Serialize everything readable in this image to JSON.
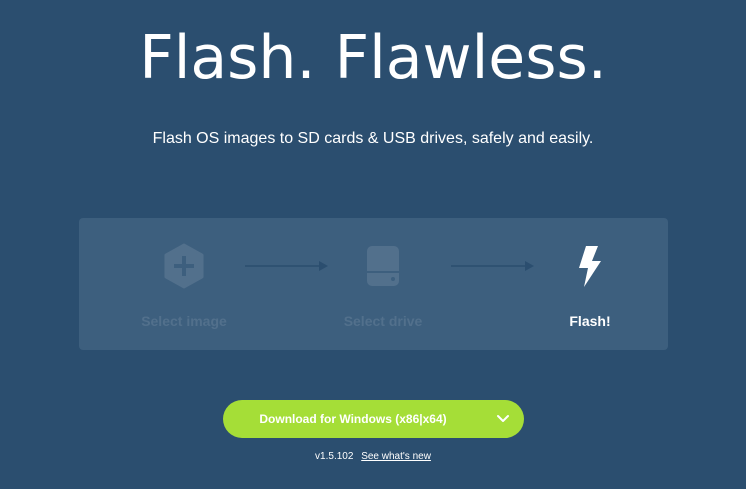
{
  "hero": {
    "title": "Flash. Flawless.",
    "subtitle": "Flash OS images to SD cards & USB drives, safely and easily."
  },
  "steps": [
    {
      "label": "Select image",
      "icon": "plus-hexagon-icon",
      "state": "disabled"
    },
    {
      "label": "Select drive",
      "icon": "drive-icon",
      "state": "disabled"
    },
    {
      "label": "Flash!",
      "icon": "lightning-icon",
      "state": "active"
    }
  ],
  "download": {
    "label": "Download for Windows (x86|x64)",
    "icon": "chevron-down-icon"
  },
  "version": {
    "number": "v1.5.102",
    "link_label": "See what's new"
  },
  "colors": {
    "background": "#2b4e6f",
    "panel": "#3d5f7e",
    "disabled": "#52708c",
    "accent": "#a5de37",
    "text": "#ffffff"
  }
}
